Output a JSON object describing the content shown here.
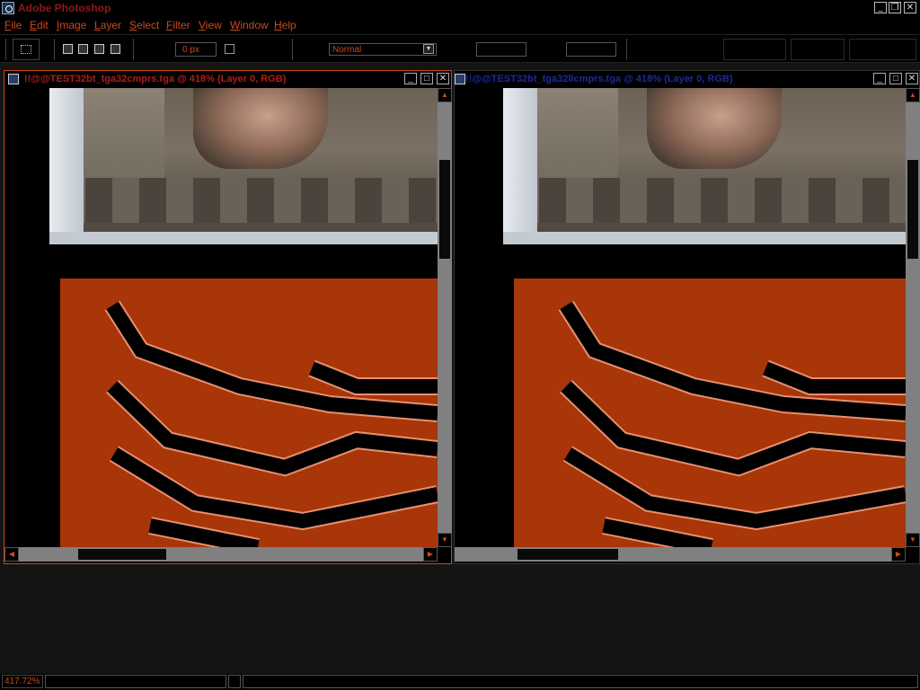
{
  "app": {
    "title": "Adobe Photoshop",
    "title_color": "#8c1a1a",
    "accent_color": "#c84a1c"
  },
  "menu": {
    "items": [
      "File",
      "Edit",
      "Image",
      "Layer",
      "Select",
      "Filter",
      "View",
      "Window",
      "Help"
    ]
  },
  "options": {
    "feather_value": "0 px",
    "style_value": "Normal"
  },
  "documents": [
    {
      "title": "!!@@TEST32bt_tga32cmprs.tga @ 418% (Layer 0, RGB)",
      "title_color": "#b01c1c",
      "active": true
    },
    {
      "title": "!!@@TEST32bt_tga32llcmprs.tga @ 418% (Layer 0, RGB)",
      "title_color": "#1c2a9a",
      "active": false
    }
  ],
  "status": {
    "zoom": "417.72%"
  },
  "icons": {
    "app": "photoshop-app-icon",
    "minimize": "minimize-icon",
    "restore": "restore-icon",
    "close": "close-icon",
    "maximize": "maximize-icon",
    "marquee": "rectangular-marquee-icon",
    "scroll_up": "arrow-up-icon",
    "scroll_down": "arrow-down-icon",
    "scroll_left": "arrow-left-icon",
    "scroll_right": "arrow-right-icon"
  }
}
